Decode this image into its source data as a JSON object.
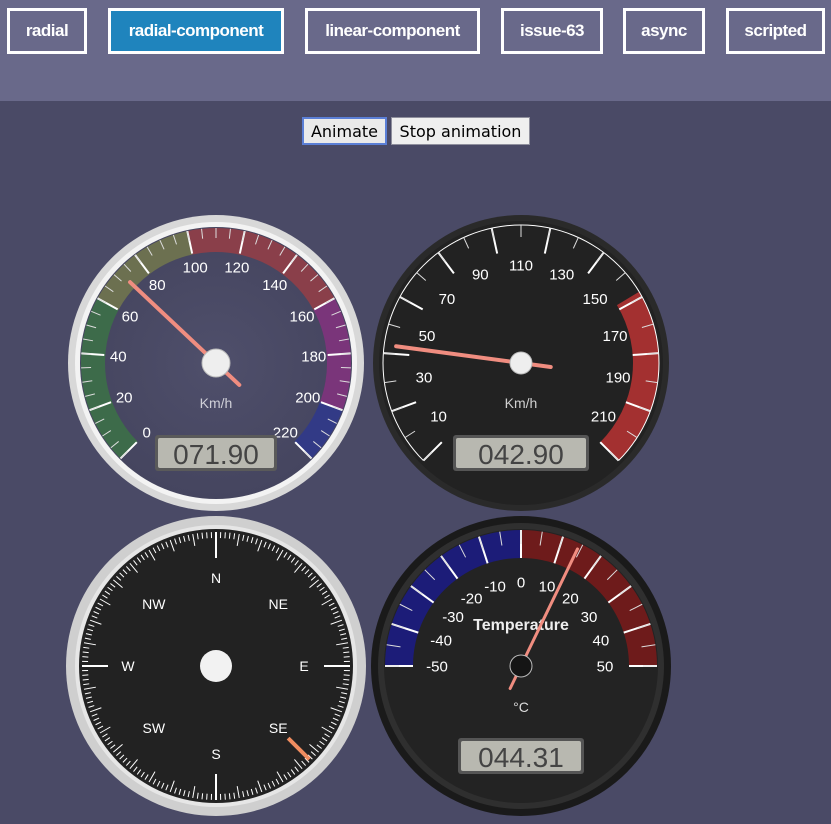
{
  "nav": {
    "tabs": [
      {
        "label": "radial",
        "active": false
      },
      {
        "label": "radial-component",
        "active": true
      },
      {
        "label": "linear-component",
        "active": false
      },
      {
        "label": "issue-63",
        "active": false
      },
      {
        "label": "async",
        "active": false
      },
      {
        "label": "scripted",
        "active": false
      }
    ]
  },
  "controls": {
    "animate_label": "Animate",
    "stop_label": "Stop animation"
  },
  "gauges": {
    "speed1": {
      "units": "Km/h",
      "value_text": "071.90",
      "value": 71.9,
      "min": 0,
      "max": 220,
      "ticks": [
        "0",
        "20",
        "40",
        "60",
        "80",
        "100",
        "120",
        "140",
        "160",
        "180",
        "200",
        "220"
      ]
    },
    "speed2": {
      "units": "Km/h",
      "value_text": "042.90",
      "value": 42.9,
      "min": 0,
      "max": 220,
      "ticks": [
        "10",
        "30",
        "50",
        "70",
        "90",
        "110",
        "130",
        "150",
        "170",
        "190",
        "210"
      ]
    },
    "compass": {
      "value": 135,
      "labels": [
        "N",
        "NE",
        "E",
        "SE",
        "S",
        "SW",
        "W",
        "NW"
      ]
    },
    "temperature": {
      "title": "Temperature",
      "units": "°C",
      "value_text": "044.31",
      "value": 14.31,
      "min": -50,
      "max": 50,
      "ticks": [
        "-50",
        "-40",
        "-30",
        "-20",
        "-10",
        "0",
        "10",
        "20",
        "30",
        "40",
        "50"
      ]
    }
  },
  "colors": {
    "active_tab": "#1f84bd",
    "page_bg": "#4a4a66",
    "bar_bg": "#69698a",
    "needle": "#f08d80",
    "speed_highlight": "#a33030",
    "cold": "#1c1c78",
    "hot": "#6e1b1b"
  }
}
